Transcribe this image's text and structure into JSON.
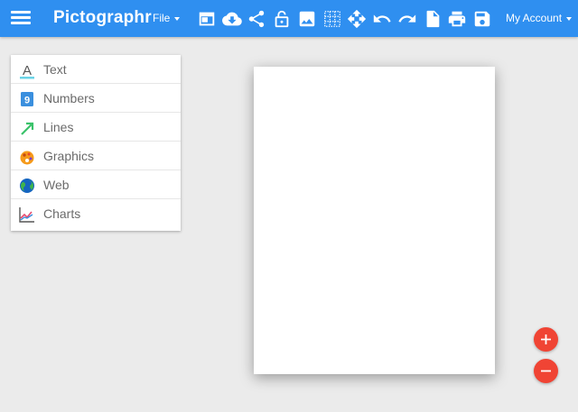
{
  "header": {
    "title": "Pictographr",
    "file_menu_label": "File",
    "account_label": "My Account",
    "brand_color": "#2f8ff0",
    "toolbar_icons": [
      "new-window-icon",
      "cloud-download-icon",
      "share-icon",
      "lock-icon",
      "image-icon",
      "grid-icon",
      "move-icon",
      "undo-icon",
      "redo-icon",
      "document-icon",
      "print-icon",
      "save-icon"
    ]
  },
  "sidebar": {
    "items": [
      {
        "label": "Text",
        "icon": "text-icon"
      },
      {
        "label": "Numbers",
        "icon": "numbers-icon"
      },
      {
        "label": "Lines",
        "icon": "lines-icon"
      },
      {
        "label": "Graphics",
        "icon": "graphics-icon"
      },
      {
        "label": "Web",
        "icon": "globe-icon"
      },
      {
        "label": "Charts",
        "icon": "charts-icon"
      }
    ]
  },
  "zoom": {
    "in_icon": "plus-icon",
    "out_icon": "minus-icon",
    "accent_color": "#f04434"
  }
}
